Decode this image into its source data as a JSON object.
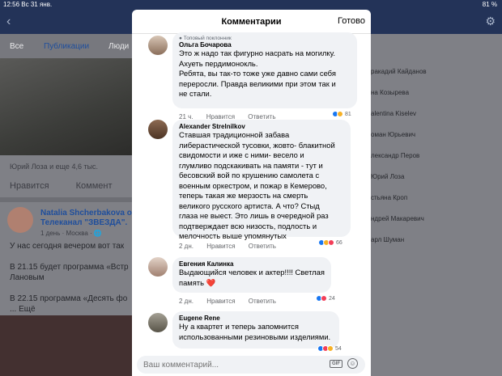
{
  "status": {
    "time": "12:56",
    "date": "Вс 31 янв.",
    "battery": "81 %"
  },
  "background": {
    "tabs": [
      "Все",
      "Публикации",
      "Люди"
    ],
    "likes_text": "Юрий Лоза и еще 4,6 тыс.",
    "actions": [
      "Нравится",
      "Коммент"
    ],
    "post": {
      "name": "Natalia Shcherbakova о\nТелеканал \"ЗВЕЗДА\".",
      "meta": "1 день · Москва · 🌐",
      "text": "У нас сегодня вечером вот так\n\nВ 21.15 будет программа «Встр\nЛановым\n\nВ 22.15 программа «Десять фо\n... Ещё"
    },
    "people": [
      "ракадий Кайданов",
      "на Козырева",
      "alentina Kiselev",
      "оман Юрьевич",
      "лександр Перов",
      "Юрий Лоза",
      "стьяна Кроп",
      "ндрей Макаревич",
      "арл Шуман"
    ]
  },
  "modal": {
    "title": "Комментарии",
    "done": "Готово",
    "comments": [
      {
        "fan_badge": "Топовый поклонник",
        "name": "Ольга Бочарова",
        "text": "Это ж надо так фигурно насрать на могилку.\nАхуеть пердимонокль.\nРебята, вы так-то тоже уже давно сами себя\nпереросли. Правда великими при этом так и\nне стали.",
        "time": "21 ч.",
        "like": "Нравится",
        "reply": "Ответить",
        "reactions": "81"
      },
      {
        "name": "Alexander Strelnilkov",
        "text": "Ставшая традиционной забава\nлиберастической тусовки, жовто- блакитной\nсвидомости и иже с ними- весело и\nглумливо подскакивать на памяти - тут и\nбесовский вой по крушению самолета с\nвоенным оркестром, и пожар в Кемерово,\nтеперь такая же мерзость на смерть\nвеликого русского артиста. А что? Стыд\nглаза не выест. Это лишь в очередной раз\nподтверждает всю низость, подлость и\nмелочность выше упомянутых",
        "time": "2 дн.",
        "like": "Нравится",
        "reply": "Ответить",
        "reactions": "66"
      },
      {
        "name": "Евгения Калинка",
        "text": "Выдающийся человек и актер!!!! Светлая\nпамять ❤️",
        "time": "2 дн.",
        "like": "Нравится",
        "reply": "Ответить",
        "reactions": "24"
      },
      {
        "name": "Eugene Rene",
        "text": "Ну а квартет и теперь запомнится\nиспользованными резиновыми изделиями.",
        "time": "",
        "like": "",
        "reply": "",
        "reactions": "54"
      }
    ],
    "input_placeholder": "Ваш комментарий...",
    "gif": "GIF",
    "emoji": "☺"
  },
  "colors": {
    "accent": "#1877f2",
    "bubble": "#f0f2f5"
  }
}
